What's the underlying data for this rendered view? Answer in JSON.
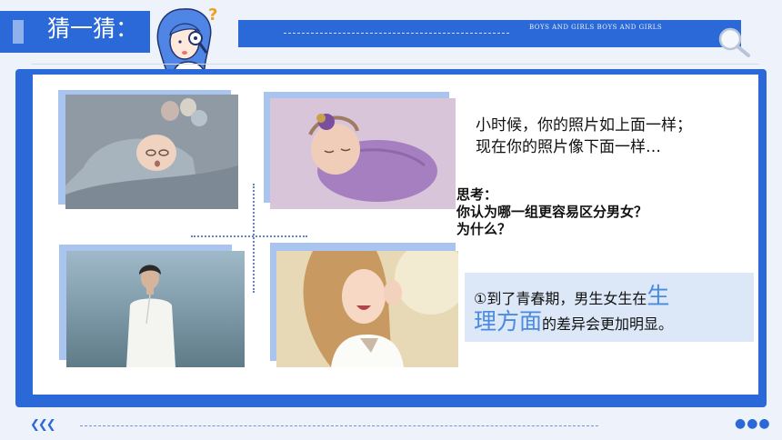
{
  "header": {
    "title": "猜一猜：",
    "caption": "BOYS AND  GIRLS    BOYS AND  GIRLS"
  },
  "content": {
    "intro_line1": "小时候，你的照片如上面一样；",
    "intro_line2": "现在你的照片像下面一样…",
    "think_label": "思考：",
    "think_question_line1": "你认为哪一组更容易区分男女？",
    "think_question_line2": "为什么？",
    "answer_prefix": "①到了青春期，男生女生在",
    "answer_highlight_1": "生",
    "answer_highlight_2": "理方面",
    "answer_suffix": "的差异会更加明显。"
  },
  "footer": {
    "arrows": "❮❮❮",
    "dots": "●●●"
  },
  "colors": {
    "primary": "#2c69d8",
    "highlight": "#4a8be0",
    "answer_bg": "#dce7f7"
  }
}
